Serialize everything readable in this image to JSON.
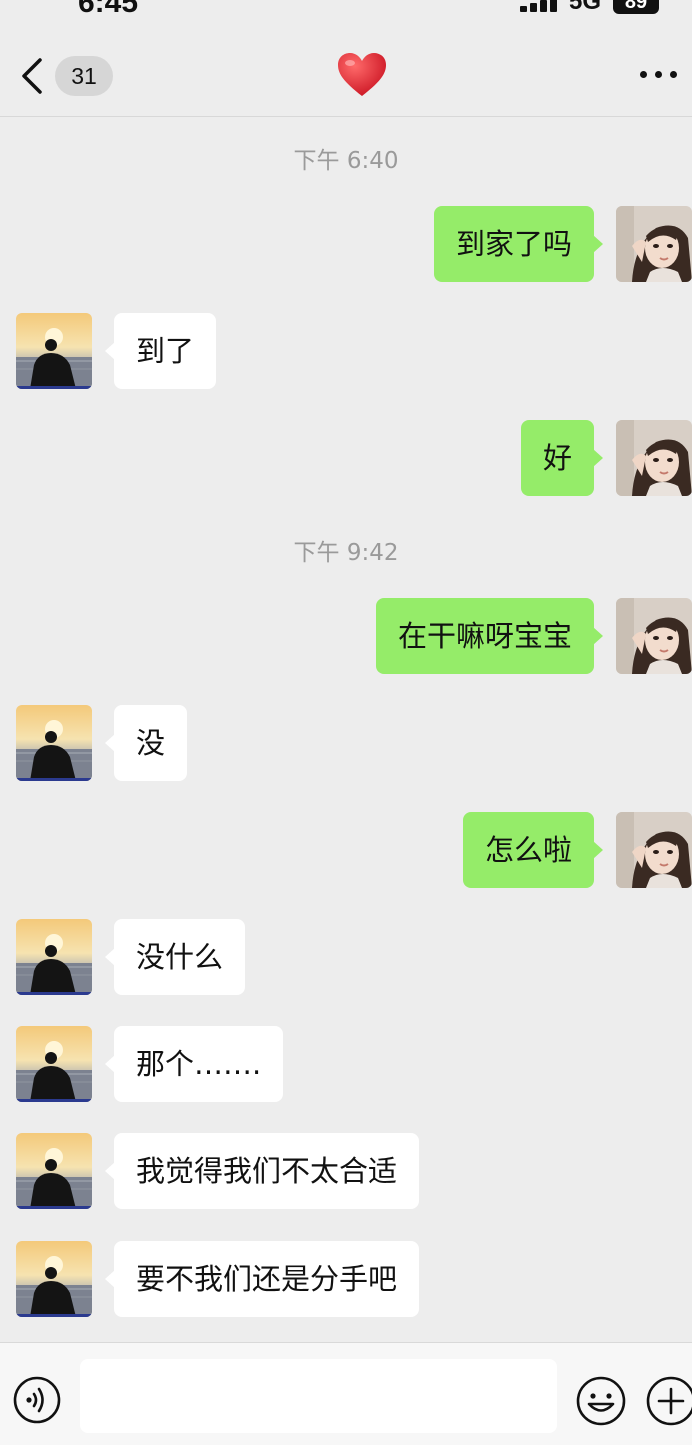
{
  "status_bar": {
    "time": "6:45",
    "network": "5G",
    "battery": "89"
  },
  "nav": {
    "back_icon": "chevron-left-icon",
    "unread_count": "31",
    "title_icon": "red-heart-icon",
    "more_icon": "more-dots-icon"
  },
  "timestamps": [
    "下午 6:40",
    "下午 9:42"
  ],
  "messages": [
    {
      "sender": "me",
      "text": "到家了吗"
    },
    {
      "sender": "them",
      "text": "到了"
    },
    {
      "sender": "me",
      "text": "好"
    },
    {
      "sender": "me",
      "text": "在干嘛呀宝宝"
    },
    {
      "sender": "them",
      "text": "没"
    },
    {
      "sender": "me",
      "text": "怎么啦"
    },
    {
      "sender": "them",
      "text": "没什么"
    },
    {
      "sender": "them",
      "text": "那个……."
    },
    {
      "sender": "them",
      "text": "我觉得我们不太合适"
    },
    {
      "sender": "them",
      "text": "要不我们还是分手吧"
    }
  ],
  "input_bar": {
    "voice_icon": "voice-icon",
    "placeholder": "",
    "emoji_icon": "emoji-icon",
    "plus_icon": "plus-icon"
  },
  "colors": {
    "background": "#ededed",
    "my_bubble": "#95ec69",
    "their_bubble": "#ffffff",
    "timestamp": "#9a9a9a"
  }
}
